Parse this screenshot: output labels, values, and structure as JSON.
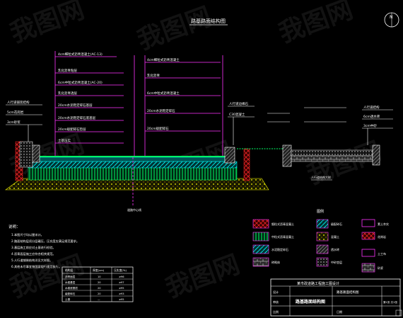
{
  "drawing": {
    "title": "路基路面结构图",
    "north_marker": "N",
    "colors": {
      "white": "#ffffff",
      "magenta": "#ff33ff",
      "cyan": "#00ffff",
      "green": "#00ff66",
      "yellow": "#ffff00",
      "red": "#ff2a2a",
      "grey": "#9a9a9a"
    }
  },
  "layer_callouts": [
    "4cm细粒式沥青混凝土(AC-13)",
    "乳化沥青粘层",
    "6cm中粒式沥青混凝土(AC-20)",
    "乳化沥青透层",
    "20cm水泥稳定碎石基层",
    "20cm水泥稳定碎石底基层",
    "20cm级配碎石垫层",
    "土基压实"
  ],
  "right_callouts": [
    "4cm细粒式沥青混凝土",
    "乳化沥青",
    "6cm中粒式沥青混凝土",
    "20cm水泥稳定碎石",
    "20cm级配碎石"
  ],
  "left_labels": [
    "人行道铺装结构",
    "5cm花岗岩",
    "3cm砂浆"
  ],
  "mid_labels": [
    "人行道边缘石",
    "C30混凝土"
  ],
  "far_right_labels": [
    "人行道结构",
    "6cm透水砖",
    "3cm中砂"
  ],
  "centerline_label": "道路中心线",
  "sidewalk_label": "人行道结构大样",
  "notes": {
    "title": "说明：",
    "items": [
      "1.本图尺寸均以厘米计。",
      "2.路面结构层须分层碾压，压实度应满足规范要求。",
      "3.基层施工前应对土基进行检验。",
      "4.沥青面层施工应符合相关规范。",
      "5.人行道铺装结构详见大样图。",
      "6.其他未尽事宜按国家现行规范执行。"
    ]
  },
  "table": {
    "headers": [
      "结构层",
      "厚度(cm)",
      "压实度(%)"
    ],
    "rows": [
      [
        "沥青面层",
        "10",
        "≥96"
      ],
      [
        "水稳基层",
        "20",
        "≥97"
      ],
      [
        "水稳底基层",
        "20",
        "≥95"
      ],
      [
        "级配碎石",
        "20",
        "≥93"
      ],
      [
        "土基",
        "—",
        "≥95"
      ]
    ]
  },
  "legend": {
    "title": "图例",
    "items": [
      "细粒式沥青混凝土",
      "中粒式沥青混凝土",
      "水泥稳定碎石",
      "级配碎石",
      "砖砌体",
      "混凝土",
      "透水砖",
      "中砂垫层",
      "素土夯实",
      "花岗岩",
      "土工布",
      "砂浆"
    ]
  },
  "title_block": {
    "project_label": "某市政道路工程施工图设计",
    "drawing_name": "路基路面结构图",
    "sheet": "第1张 共1张",
    "role1": "设计",
    "role2": "审核",
    "scale": "比例",
    "date": "日期"
  },
  "watermark": "我图网"
}
